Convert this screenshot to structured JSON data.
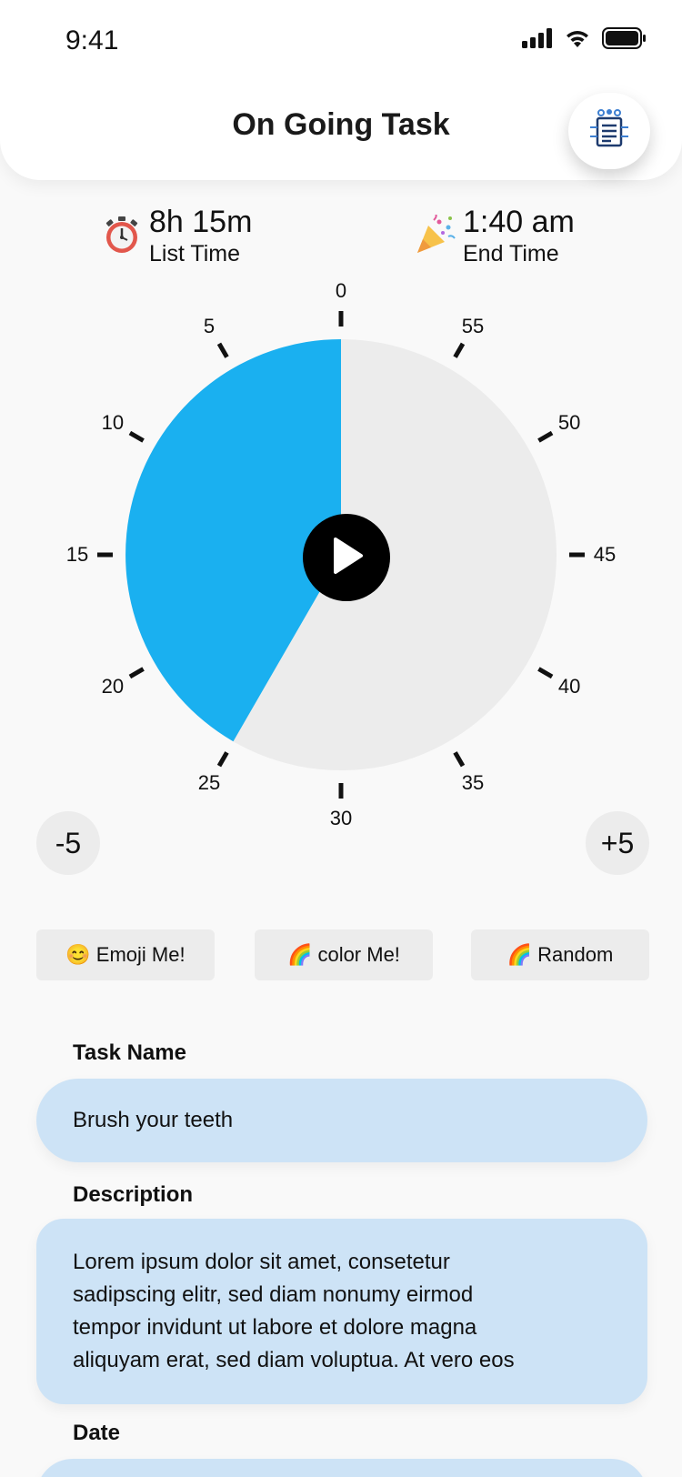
{
  "status": {
    "time": "9:41"
  },
  "header": {
    "title": "On Going Task",
    "doc_icon": "document-settings-icon"
  },
  "info": {
    "list": {
      "value": "8h 15m",
      "label": "List Time",
      "icon": "stopwatch-icon"
    },
    "end": {
      "value": "1:40 am",
      "label": "End Time",
      "icon": "party-popper-icon"
    }
  },
  "clock": {
    "tick_labels": [
      "0",
      "5",
      "10",
      "15",
      "20",
      "25",
      "30",
      "35",
      "40",
      "45",
      "50",
      "55"
    ],
    "elapsed_minutes": 25,
    "total_minutes": 60,
    "fill_color": "#1ab0f0",
    "track_color": "#ececec"
  },
  "controls": {
    "minus_label": "-5",
    "plus_label": "+5"
  },
  "actions": {
    "emoji": {
      "icon": "😊",
      "label": "Emoji Me!"
    },
    "color": {
      "icon": "🌈",
      "label": "color Me!"
    },
    "random": {
      "icon": "🌈",
      "label": "Random"
    }
  },
  "form": {
    "task_name_label": "Task Name",
    "task_name_value": "Brush your teeth",
    "description_label": "Description",
    "description_lines": [
      "Lorem ipsum dolor sit amet, consetetur",
      "sadipscing elitr, sed diam nonumy eirmod",
      "tempor invidunt ut labore et dolore magna",
      "aliquyam erat, sed diam voluptua. At vero eos"
    ],
    "date_label": "Date"
  },
  "colors": {
    "accent": "#1ab0f0",
    "field_bg": "#cde3f6"
  }
}
